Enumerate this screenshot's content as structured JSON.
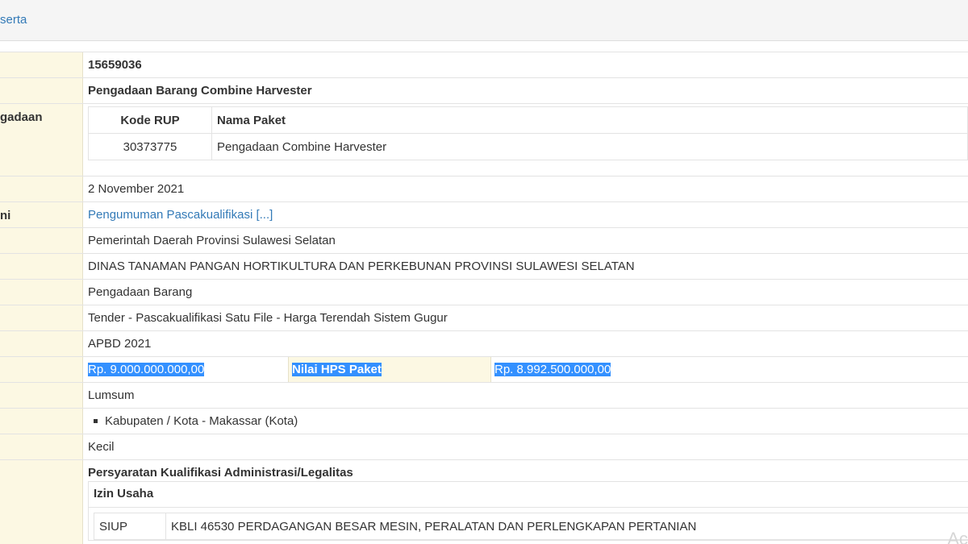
{
  "header": {
    "tab_label": "serta"
  },
  "rows": {
    "kode_tender": {
      "value": "15659036"
    },
    "nama_tender": {
      "value": "Pengadaan Barang Combine Harvester"
    },
    "rup": {
      "label": "gadaan",
      "columns": [
        "Kode RUP",
        "Nama Paket"
      ],
      "items": [
        {
          "kode": "30373775",
          "nama": "Pengadaan Combine Harvester"
        }
      ]
    },
    "tanggal": {
      "value": "2 November 2021"
    },
    "tahap": {
      "label": "ni",
      "value": "Pengumuman Pascakualifikasi [...]"
    },
    "instansi": {
      "value": "Pemerintah Daerah Provinsi Sulawesi Selatan"
    },
    "satker": {
      "value": "DINAS TANAMAN PANGAN HORTIKULTURA DAN PERKEBUNAN PROVINSI SULAWESI SELATAN"
    },
    "kategori": {
      "value": "Pengadaan Barang"
    },
    "metode": {
      "value": "Tender - Pascakualifikasi Satu File - Harga Terendah Sistem Gugur"
    },
    "anggaran": {
      "value": "APBD 2021"
    },
    "pagu": {
      "value": "Rp. 9.000.000.000,00",
      "hps_label": "Nilai HPS Paket",
      "hps_value": "Rp. 8.992.500.000,00"
    },
    "kontrak": {
      "value": "Lumsum"
    },
    "lokasi": {
      "items": [
        "Kabupaten / Kota - Makassar (Kota)"
      ]
    },
    "kualifikasi_usaha": {
      "value": "Kecil"
    },
    "syarat": {
      "title": "Persyaratan Kualifikasi Administrasi/Legalitas",
      "sub_title": "Izin Usaha",
      "items": [
        {
          "jenis": "SIUP",
          "klasifikasi": "KBLI 46530 PERDAGANGAN BESAR MESIN, PERALATAN DAN PERLENGKAPAN PERTANIAN"
        }
      ]
    }
  },
  "watermark": "Ac"
}
